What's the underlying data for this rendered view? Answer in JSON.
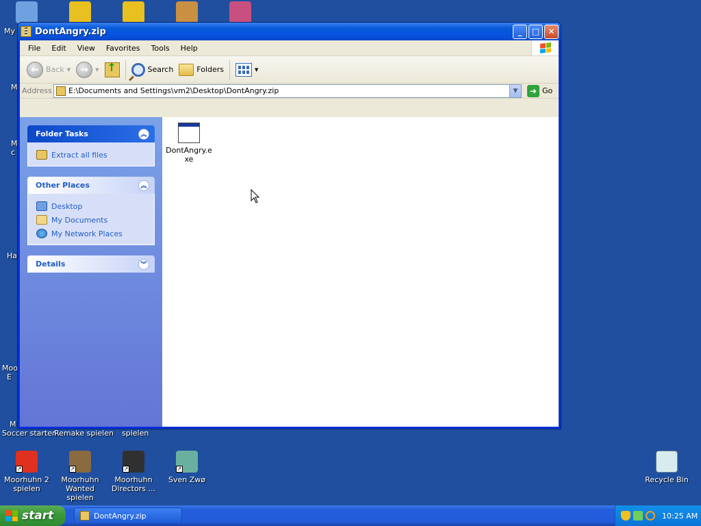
{
  "desktop": {
    "icons": [
      {
        "label": "",
        "name": "my-computer-icon",
        "color": "#6fa0e0"
      },
      {
        "label": "",
        "name": "moorhuhn-chicken-icon",
        "color": "#e8c020"
      },
      {
        "label": "",
        "name": "moorhuhn-chicken-icon-2",
        "color": "#e8c020"
      },
      {
        "label": "",
        "name": "game-character-icon",
        "color": "#c89040"
      },
      {
        "label": "",
        "name": "game-character-icon-2",
        "color": "#c85080"
      }
    ],
    "left_edge_labels": [
      "My",
      "M",
      "M\nc",
      "Ha",
      "Moo\nE",
      "M"
    ],
    "row_labels": [
      "Soccer starten",
      "Remake spielen",
      "spielen"
    ],
    "bottom_icons": [
      {
        "label": "Moorhuhn 2 spielen"
      },
      {
        "label": "Moorhuhn Wanted spielen"
      },
      {
        "label": "Moorhuhn Directors ..."
      },
      {
        "label": "Sven Zwø"
      }
    ],
    "recycle_bin": "Recycle Bin"
  },
  "window": {
    "title": "DontAngry.zip",
    "menu": [
      "File",
      "Edit",
      "View",
      "Favorites",
      "Tools",
      "Help"
    ],
    "toolbar": {
      "back": "Back",
      "search": "Search",
      "folders": "Folders"
    },
    "address": {
      "label": "Address",
      "value": "E:\\Documents and Settings\\vm2\\Desktop\\DontAngry.zip",
      "go": "Go"
    },
    "task_pane": {
      "folder_tasks": {
        "title": "Folder Tasks",
        "items": [
          "Extract all files"
        ]
      },
      "other_places": {
        "title": "Other Places",
        "items": [
          "Desktop",
          "My Documents",
          "My Network Places"
        ]
      },
      "details": {
        "title": "Details"
      }
    },
    "files": [
      {
        "name": "DontAngry.exe"
      }
    ]
  },
  "taskbar": {
    "start": "start",
    "task_button": "DontAngry.zip",
    "clock": "10:25 AM"
  }
}
